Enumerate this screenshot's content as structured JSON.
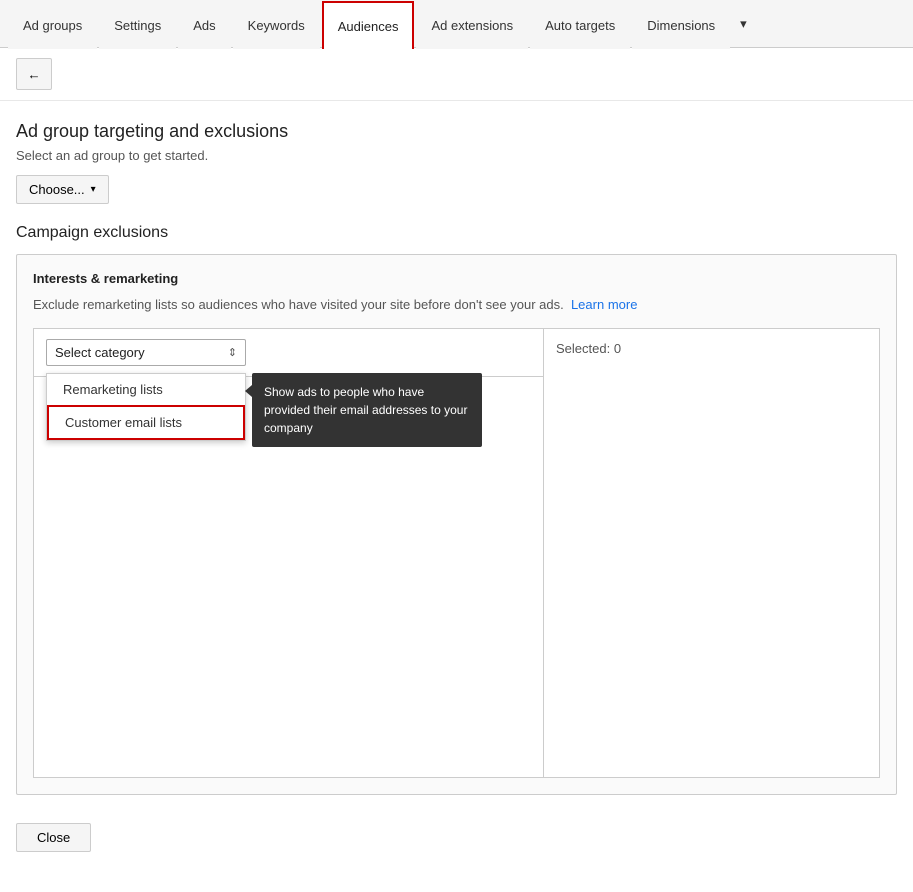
{
  "tabs": [
    {
      "id": "ad-groups",
      "label": "Ad groups",
      "active": false
    },
    {
      "id": "settings",
      "label": "Settings",
      "active": false
    },
    {
      "id": "ads",
      "label": "Ads",
      "active": false
    },
    {
      "id": "keywords",
      "label": "Keywords",
      "active": false
    },
    {
      "id": "audiences",
      "label": "Audiences",
      "active": true
    },
    {
      "id": "ad-extensions",
      "label": "Ad extensions",
      "active": false
    },
    {
      "id": "auto-targets",
      "label": "Auto targets",
      "active": false
    },
    {
      "id": "dimensions",
      "label": "Dimensions",
      "active": false
    }
  ],
  "more_label": "▾",
  "page_title": "Ad group targeting and exclusions",
  "subtitle": "Select an ad group to get started.",
  "choose_label": "Choose...",
  "section_title": "Campaign exclusions",
  "box_title": "Interests & remarketing",
  "box_desc_prefix": "Exclude remarketing lists so audiences who have visited your site before don't see your ads.",
  "learn_more_label": "Learn more",
  "select_category_placeholder": "Select category",
  "dropdown_items": [
    {
      "id": "remarketing",
      "label": "Remarketing lists",
      "highlighted": false
    },
    {
      "id": "customer-email",
      "label": "Customer email lists",
      "highlighted": true
    }
  ],
  "tooltip_text": "Show ads to people who have provided their email addresses to your company",
  "selected_label": "Selected: 0",
  "close_label": "Close",
  "back_icon": "←"
}
